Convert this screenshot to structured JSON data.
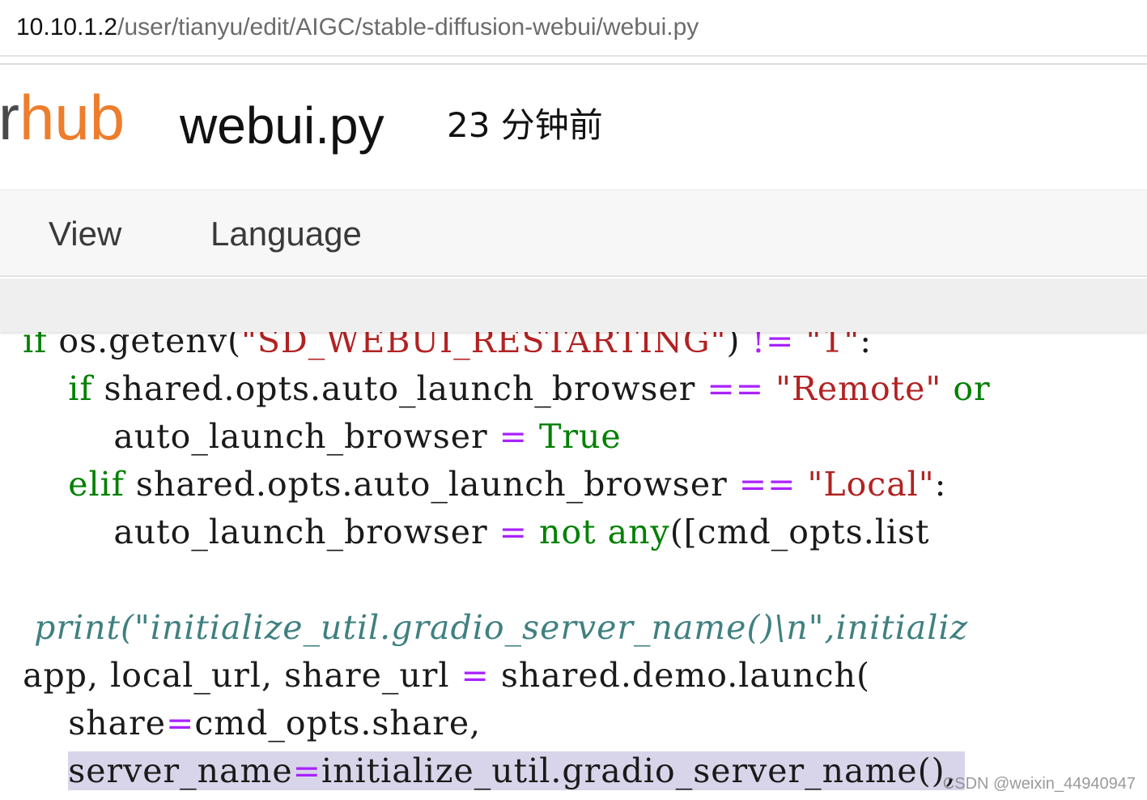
{
  "url_bar": {
    "host": "10.10.1.2",
    "path": "/user/tianyu/edit/AIGC/stable-diffusion-webui/webui.py"
  },
  "header": {
    "logo_part1": "r",
    "logo_part2": "hub",
    "filename": "webui.py",
    "last_modified": "23 分钟前"
  },
  "menu": {
    "items": [
      {
        "label": "View"
      },
      {
        "label": "Language"
      }
    ]
  },
  "code": {
    "line1": {
      "indent": "  ",
      "kw": "if",
      "t1": " os.getenv(",
      "s1": "\"SD_WEBUI_RESTARTING\"",
      "t2": ") ",
      "op": "!=",
      "t3": " ",
      "s2": "\"1\"",
      "t4": ":"
    },
    "line2": {
      "indent": "      ",
      "kw": "if",
      "t1": " shared.opts.auto_launch_browser ",
      "op": "==",
      "t2": " ",
      "s1": "\"Remote\"",
      "t3": " ",
      "kw2": "or"
    },
    "line3": {
      "indent": "          ",
      "t1": "auto_launch_browser ",
      "op": "=",
      "t2": " ",
      "kw": "True"
    },
    "line4": {
      "indent": "      ",
      "kw": "elif",
      "t1": " shared.opts.auto_launch_browser ",
      "op": "==",
      "t2": " ",
      "s1": "\"Local\"",
      "t3": ":"
    },
    "line5": {
      "indent": "          ",
      "t1": "auto_launch_browser ",
      "op": "=",
      "t2": " ",
      "kw": "not",
      "t3": " ",
      "fn": "any",
      "t4": "([cmd_opts.list"
    },
    "line6": {
      "text": ""
    },
    "line7": {
      "indent": "   ",
      "cmt": "print(\"initialize_util.gradio_server_name()\\n\",initializ"
    },
    "line8": {
      "indent": "  ",
      "t1": "app, local_url, share_url ",
      "op": "=",
      "t2": " shared.demo.launch("
    },
    "line9": {
      "indent": "      ",
      "t1": "share",
      "op": "=",
      "t2": "cmd_opts.share,"
    },
    "line10": {
      "indent": "      ",
      "t1": "server_name",
      "op": "=",
      "t2": "initialize_util.gradio_server_name(),"
    }
  },
  "watermark": "CSDN @weixin_44940947",
  "colors": {
    "keyword": "#008000",
    "string": "#b22222",
    "operator": "#aa22ff",
    "comment": "#408080",
    "logo_accent": "#ee7d2c",
    "highlight": "#d8d5ea"
  }
}
